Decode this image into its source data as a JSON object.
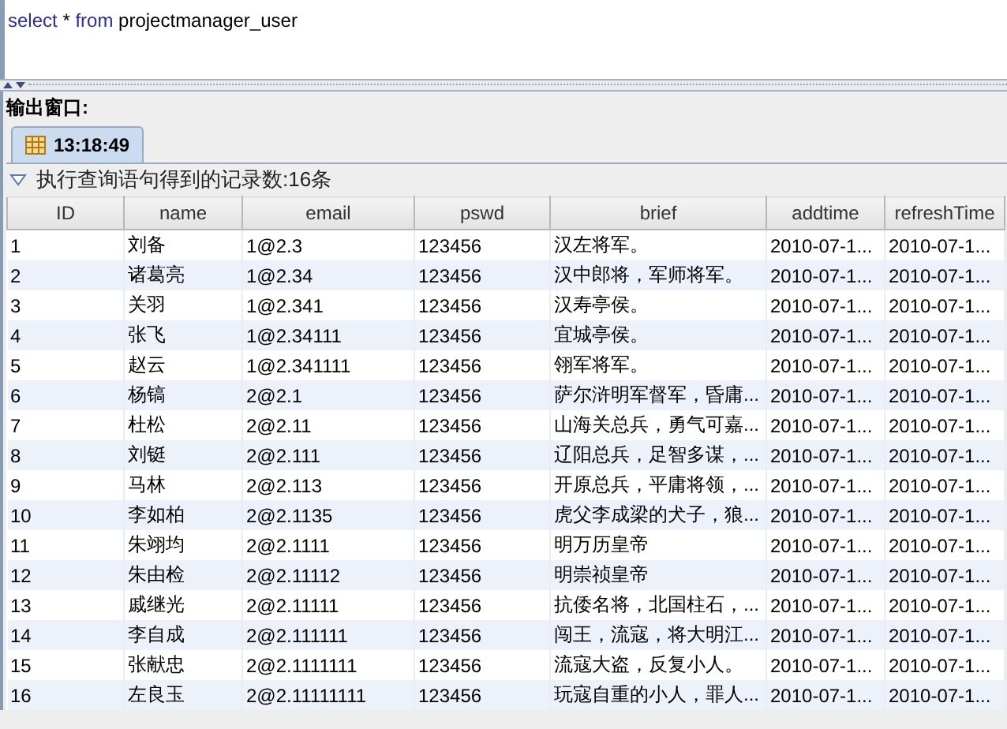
{
  "editor": {
    "query": [
      {
        "kind": "keyword",
        "text": "select"
      },
      {
        "kind": "plain",
        "text": "*"
      },
      {
        "kind": "keyword",
        "text": "from"
      },
      {
        "kind": "plain",
        "text": "projectmanager_user"
      }
    ]
  },
  "output": {
    "label": "输出窗口:",
    "tabs": [
      {
        "label": "13:18:49",
        "selected": true
      }
    ],
    "section": {
      "title": "执行查询语句得到的记录数:16条",
      "expanded": true
    },
    "table": {
      "columns": [
        "ID",
        "name",
        "email",
        "pswd",
        "brief",
        "addtime",
        "refreshTime"
      ],
      "rows": [
        [
          "1",
          "刘备",
          "1@2.3",
          "123456",
          "汉左将军。",
          "2010-07-1...",
          "2010-07-1..."
        ],
        [
          "2",
          "诸葛亮",
          "1@2.34",
          "123456",
          "汉中郎将，军师将军。",
          "2010-07-1...",
          "2010-07-1..."
        ],
        [
          "3",
          "关羽",
          "1@2.341",
          "123456",
          "汉寿亭侯。",
          "2010-07-1...",
          "2010-07-1..."
        ],
        [
          "4",
          "张飞",
          "1@2.34111",
          "123456",
          "宜城亭侯。",
          "2010-07-1...",
          "2010-07-1..."
        ],
        [
          "5",
          "赵云",
          "1@2.341111",
          "123456",
          "翎军将军。",
          "2010-07-1...",
          "2010-07-1..."
        ],
        [
          "6",
          "杨镐",
          "2@2.1",
          "123456",
          "萨尔浒明军督军，昏庸...",
          "2010-07-1...",
          "2010-07-1..."
        ],
        [
          "7",
          "杜松",
          "2@2.11",
          "123456",
          "山海关总兵，勇气可嘉...",
          "2010-07-1...",
          "2010-07-1..."
        ],
        [
          "8",
          "刘铤",
          "2@2.111",
          "123456",
          "辽阳总兵，足智多谋，...",
          "2010-07-1...",
          "2010-07-1..."
        ],
        [
          "9",
          "马林",
          "2@2.113",
          "123456",
          "开原总兵，平庸将领，...",
          "2010-07-1...",
          "2010-07-1..."
        ],
        [
          "10",
          "李如柏",
          "2@2.1135",
          "123456",
          "虎父李成梁的犬子，狼...",
          "2010-07-1...",
          "2010-07-1..."
        ],
        [
          "11",
          "朱翊均",
          "2@2.1111",
          "123456",
          "明万历皇帝",
          "2010-07-1...",
          "2010-07-1..."
        ],
        [
          "12",
          "朱由检",
          "2@2.11112",
          "123456",
          "明崇祯皇帝",
          "2010-07-1...",
          "2010-07-1..."
        ],
        [
          "13",
          "戚继光",
          "2@2.11111",
          "123456",
          "抗倭名将，北国柱石，...",
          "2010-07-1...",
          "2010-07-1..."
        ],
        [
          "14",
          "李自成",
          "2@2.111111",
          "123456",
          "闯王，流寇，将大明江...",
          "2010-07-1...",
          "2010-07-1..."
        ],
        [
          "15",
          "张献忠",
          "2@2.1111111",
          "123456",
          "流寇大盗，反复小人。",
          "2010-07-1...",
          "2010-07-1..."
        ],
        [
          "16",
          "左良玉",
          "2@2.11111111",
          "123456",
          "玩寇自重的小人，罪人...",
          "2010-07-1...",
          "2010-07-1..."
        ]
      ]
    }
  }
}
